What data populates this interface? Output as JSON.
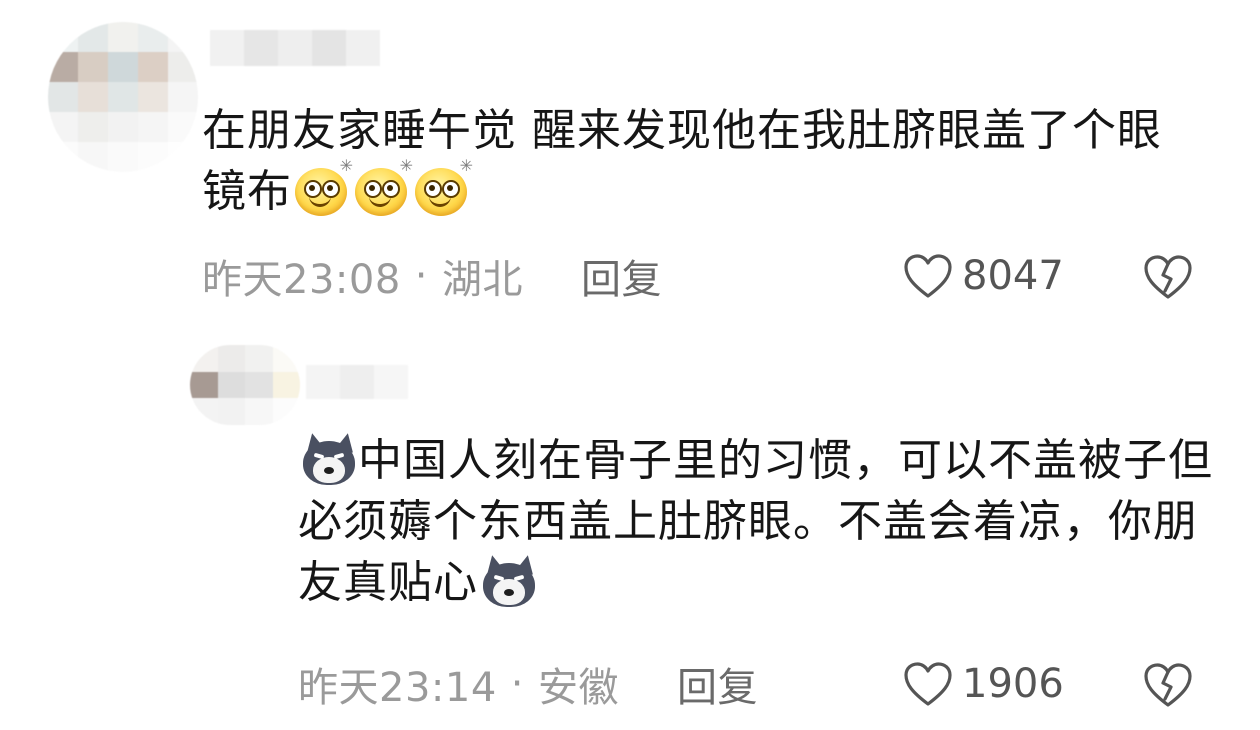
{
  "comments": [
    {
      "text": "在朋友家睡午觉 醒来发现他在我肚脐眼盖了个眼镜布",
      "emoji": [
        "smile-face",
        "smile-face",
        "smile-face"
      ],
      "time": "昨天23:08",
      "separator": "·",
      "location": "湖北",
      "reply_label": "回复",
      "likes": "8047"
    },
    {
      "text_before": "中国人刻在骨子里的习惯，可以不盖被子但必须薅个东西盖上肚脐眼。不盖会着凉，你朋友真贴心",
      "emoji": [
        "dog-face",
        "dog-face"
      ],
      "time": "昨天23:14",
      "separator": "·",
      "location": "安徽",
      "reply_label": "回复",
      "likes": "1906"
    }
  ],
  "colors": {
    "text": "#161616",
    "meta": "#9a9a9a",
    "reply": "#6a6a6a",
    "icon": "#555555"
  },
  "icons": [
    "heart-outline-icon",
    "broken-heart-icon",
    "smile-face-emoji",
    "dog-face-emoji"
  ]
}
